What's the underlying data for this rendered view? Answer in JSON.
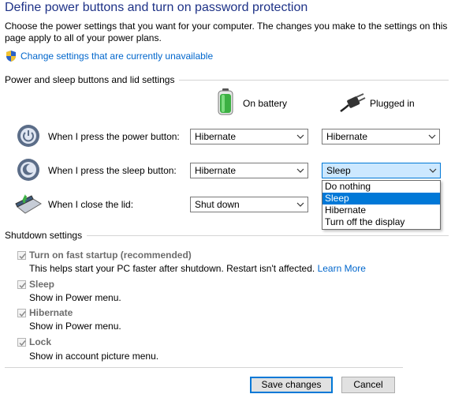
{
  "header": {
    "title": "Define power buttons and turn on password protection",
    "intro": "Choose the power settings that you want for your computer. The changes you make to the settings on this page apply to all of your power plans.",
    "change_settings_link": "Change settings that are currently unavailable"
  },
  "power_section": {
    "title": "Power and sleep buttons and lid settings",
    "columns": {
      "battery": "On battery",
      "plugged": "Plugged in"
    },
    "rows": [
      {
        "label": "When I press the power button:",
        "battery": "Hibernate",
        "plugged": "Hibernate"
      },
      {
        "label": "When I press the sleep button:",
        "battery": "Hibernate",
        "plugged": "Sleep"
      },
      {
        "label": "When I close the lid:",
        "battery": "Shut down"
      }
    ],
    "open_dropdown": {
      "options": [
        "Do nothing",
        "Sleep",
        "Hibernate",
        "Turn off the display"
      ],
      "selected": "Sleep"
    }
  },
  "shutdown_section": {
    "title": "Shutdown settings",
    "items": [
      {
        "label": "Turn on fast startup (recommended)",
        "desc": "This helps start your PC faster after shutdown. Restart isn't affected.",
        "link": "Learn More",
        "checked": true
      },
      {
        "label": "Sleep",
        "desc": "Show in Power menu.",
        "checked": true
      },
      {
        "label": "Hibernate",
        "desc": "Show in Power menu.",
        "checked": true
      },
      {
        "label": "Lock",
        "desc": "Show in account picture menu.",
        "checked": true
      }
    ]
  },
  "footer": {
    "save_label": "Save changes",
    "cancel_label": "Cancel"
  },
  "colors": {
    "title": "#1e3287",
    "link": "#0066cc",
    "accent": "#0078d7",
    "battery_green": "#3cb043",
    "disabled_text": "#6d6d6d"
  },
  "icons": [
    "shield-icon",
    "battery-icon",
    "plug-icon",
    "power-button-icon",
    "sleep-button-icon",
    "laptop-lid-icon",
    "chevron-down-icon",
    "checkmark-icon"
  ]
}
